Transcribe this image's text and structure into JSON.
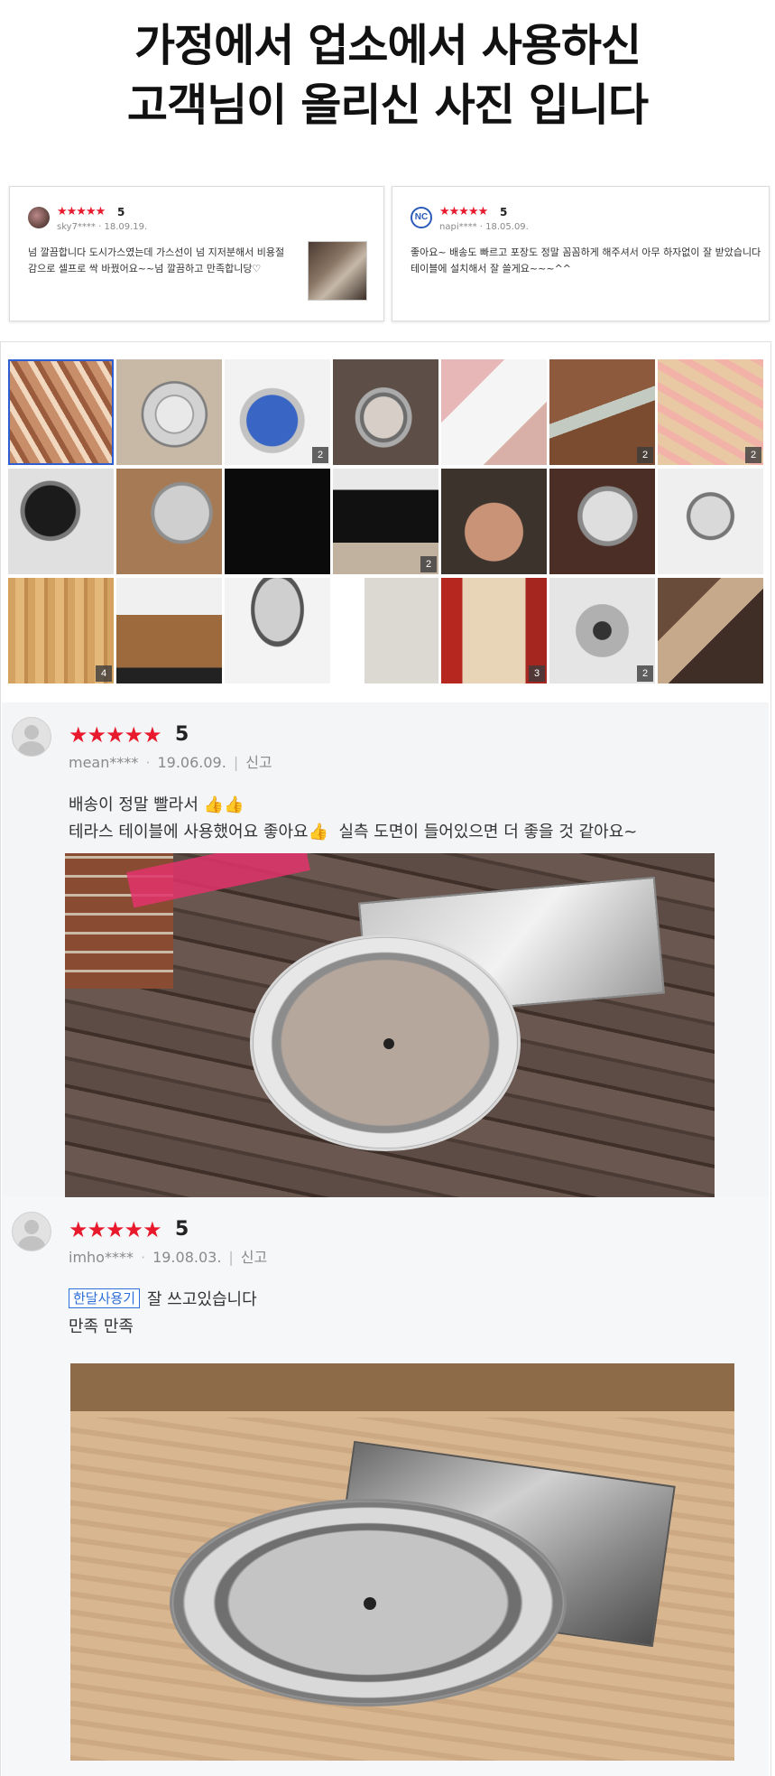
{
  "headline": {
    "line1": "가정에서 업소에서 사용하신",
    "line2": "고객님이 올리신 사진 입니다"
  },
  "mini_reviews": [
    {
      "stars": "★★★★★",
      "score": "5",
      "user": "sky7****",
      "date": "18.09.19.",
      "text": "넘 깔끔합니다 도시가스였는데 가스선이 넘 지저분해서 비용절감으로 셀프로 싹 바꿨어요~~넘 깔끔하고 만족합니당♡"
    },
    {
      "stars": "★★★★★",
      "score": "5",
      "user": "napi****",
      "date": "18.05.09.",
      "text": "좋아요~ 배송도 빠르고 포장도 정말 꼼꼼하게 해주셔서 아무 하자없이 잘 받았습니다 테이블에 설치해서 잘 쓸게요~~~^^",
      "logo_text": "NC"
    }
  ],
  "photo_grid": {
    "counts": [
      "",
      "",
      "2",
      "",
      "",
      "2",
      "2",
      "",
      "",
      "",
      "2",
      "",
      "",
      "",
      "4",
      "",
      "",
      "",
      "3",
      "2",
      ""
    ]
  },
  "reviews": [
    {
      "stars": "★★★★★",
      "score": "5",
      "user": "mean****",
      "date": "19.06.09.",
      "report": "신고",
      "line1": "배송이 정말 빨라서",
      "line1_emoji": "👍👍",
      "line2": "테라스 테이블에 사용했어요 좋아요",
      "line2_emoji": "👍",
      "line2_rest": "실측 도면이 들어있으면 더 좋을 것 같아요~"
    },
    {
      "stars": "★★★★★",
      "score": "5",
      "user": "imho****",
      "date": "19.08.03.",
      "report": "신고",
      "badge": "한달사용기",
      "line1": "잘 쓰고있습니다",
      "line2": "만족 만족"
    }
  ],
  "colors": {
    "star": "#e8192c",
    "badge": "#2d6fd8",
    "selected_outline": "#2d5fd3"
  }
}
